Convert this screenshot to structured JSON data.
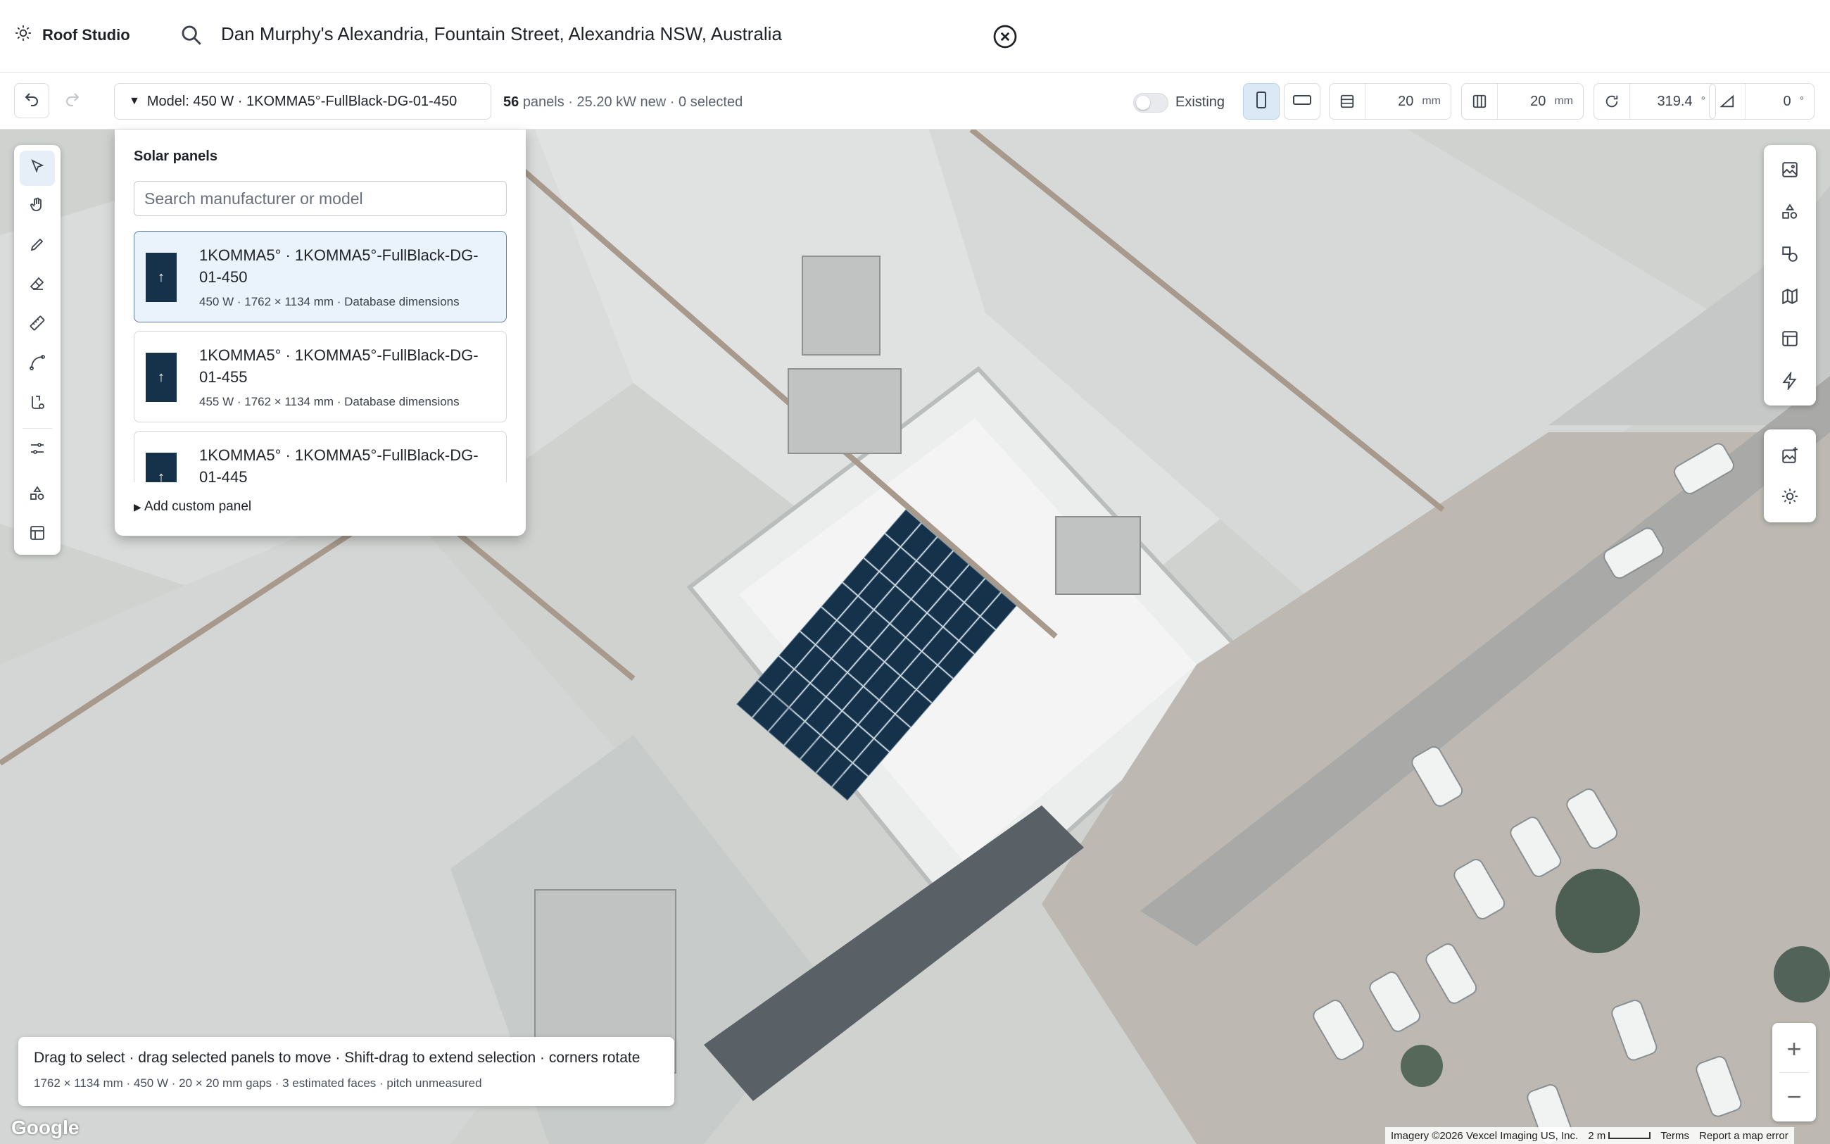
{
  "app": {
    "title": "Roof Studio"
  },
  "search": {
    "value": "Dan Murphy's Alexandria, Fountain Street, Alexandria NSW, Australia"
  },
  "toolbar": {
    "model_label": "Model: 450 W · 1KOMMA5°-FullBlack-DG-01-450",
    "panel_count": "56",
    "panel_summary": "panels · 25.20 kW new · 0 selected",
    "existing_label": "Existing",
    "row_gap": {
      "value": "20",
      "unit": "mm"
    },
    "col_gap": {
      "value": "20",
      "unit": "mm"
    },
    "rotation": {
      "value": "319.4",
      "unit": "°"
    },
    "pitch": {
      "value": "0",
      "unit": "°"
    }
  },
  "dropdown": {
    "title": "Solar panels",
    "search_placeholder": "Search manufacturer or model",
    "options": [
      {
        "name": "1KOMMA5° · 1KOMMA5°-FullBlack-DG-01-450",
        "meta": "450 W · 1762 × 1134 mm · Database dimensions",
        "selected": true
      },
      {
        "name": "1KOMMA5° · 1KOMMA5°-FullBlack-DG-01-455",
        "meta": "455 W · 1762 × 1134 mm · Database dimensions",
        "selected": false
      },
      {
        "name": "1KOMMA5° · 1KOMMA5°-FullBlack-DG-01-445",
        "meta": "",
        "selected": false
      }
    ],
    "custom_label": "Add custom panel"
  },
  "hint": {
    "line1": "Drag to select · drag selected panels to move · Shift-drag to extend selection · corners rotate",
    "line2": "1762 × 1134 mm · 450 W · 20 × 20 mm gaps · 3 estimated faces · pitch unmeasured"
  },
  "map": {
    "logo": "Google",
    "imagery": "Imagery ©2026 Vexcel Imaging US, Inc.",
    "scale": "2 m",
    "terms": "Terms",
    "report": "Report a map error"
  },
  "colors": {
    "accent": "#dbe9f6",
    "panel": "#16324a",
    "selected_border": "#5f7f9e"
  }
}
